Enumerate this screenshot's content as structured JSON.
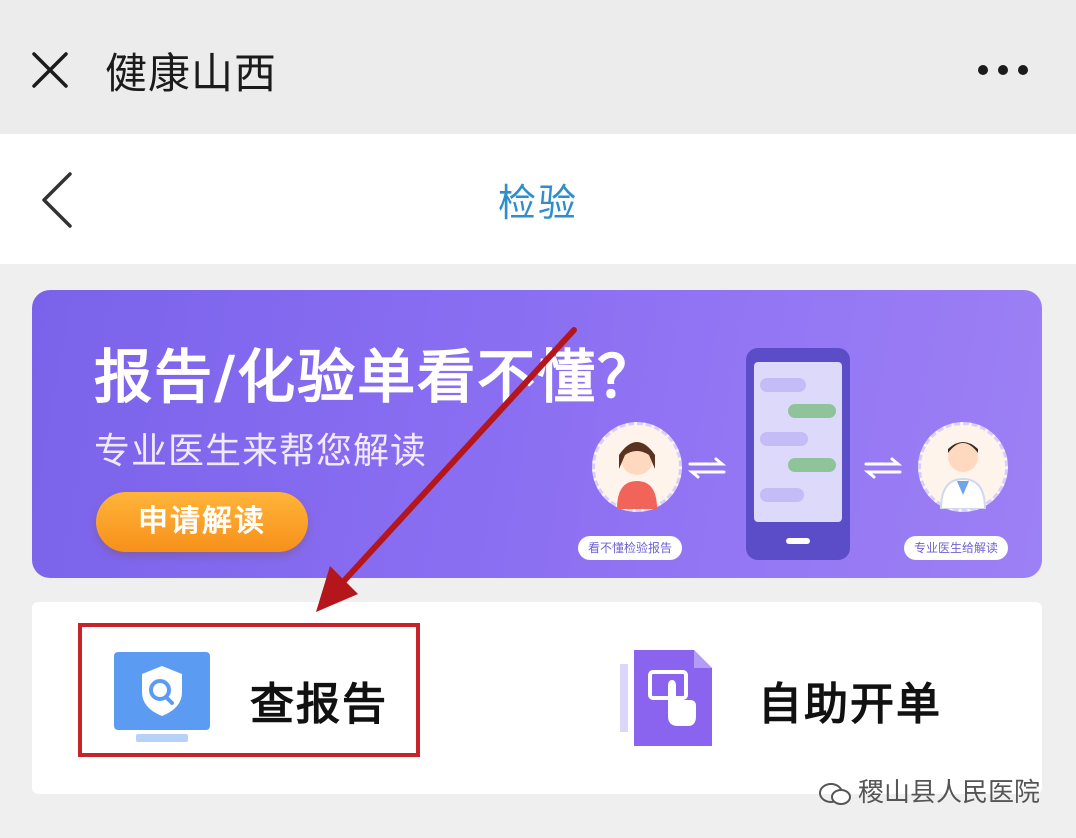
{
  "topbar": {
    "title": "健康山西"
  },
  "navbar": {
    "title": "检验"
  },
  "banner": {
    "headline": "报告/化验单看不懂？",
    "subtitle": "专业医生来帮您解读",
    "button_label": "申请解读",
    "left_tag": "看不懂检验报告",
    "right_tag": "专业医生给解读"
  },
  "menu": {
    "items": [
      {
        "label": "查报告",
        "icon": "shield-search-icon"
      },
      {
        "label": "自助开单",
        "icon": "touch-order-icon"
      }
    ]
  },
  "watermark": {
    "text": "稷山县人民医院"
  },
  "colors": {
    "accent": "#2d8ec9",
    "banner": "#8a6ef2",
    "highlight": "#c7232a",
    "button": "#f7901a"
  }
}
